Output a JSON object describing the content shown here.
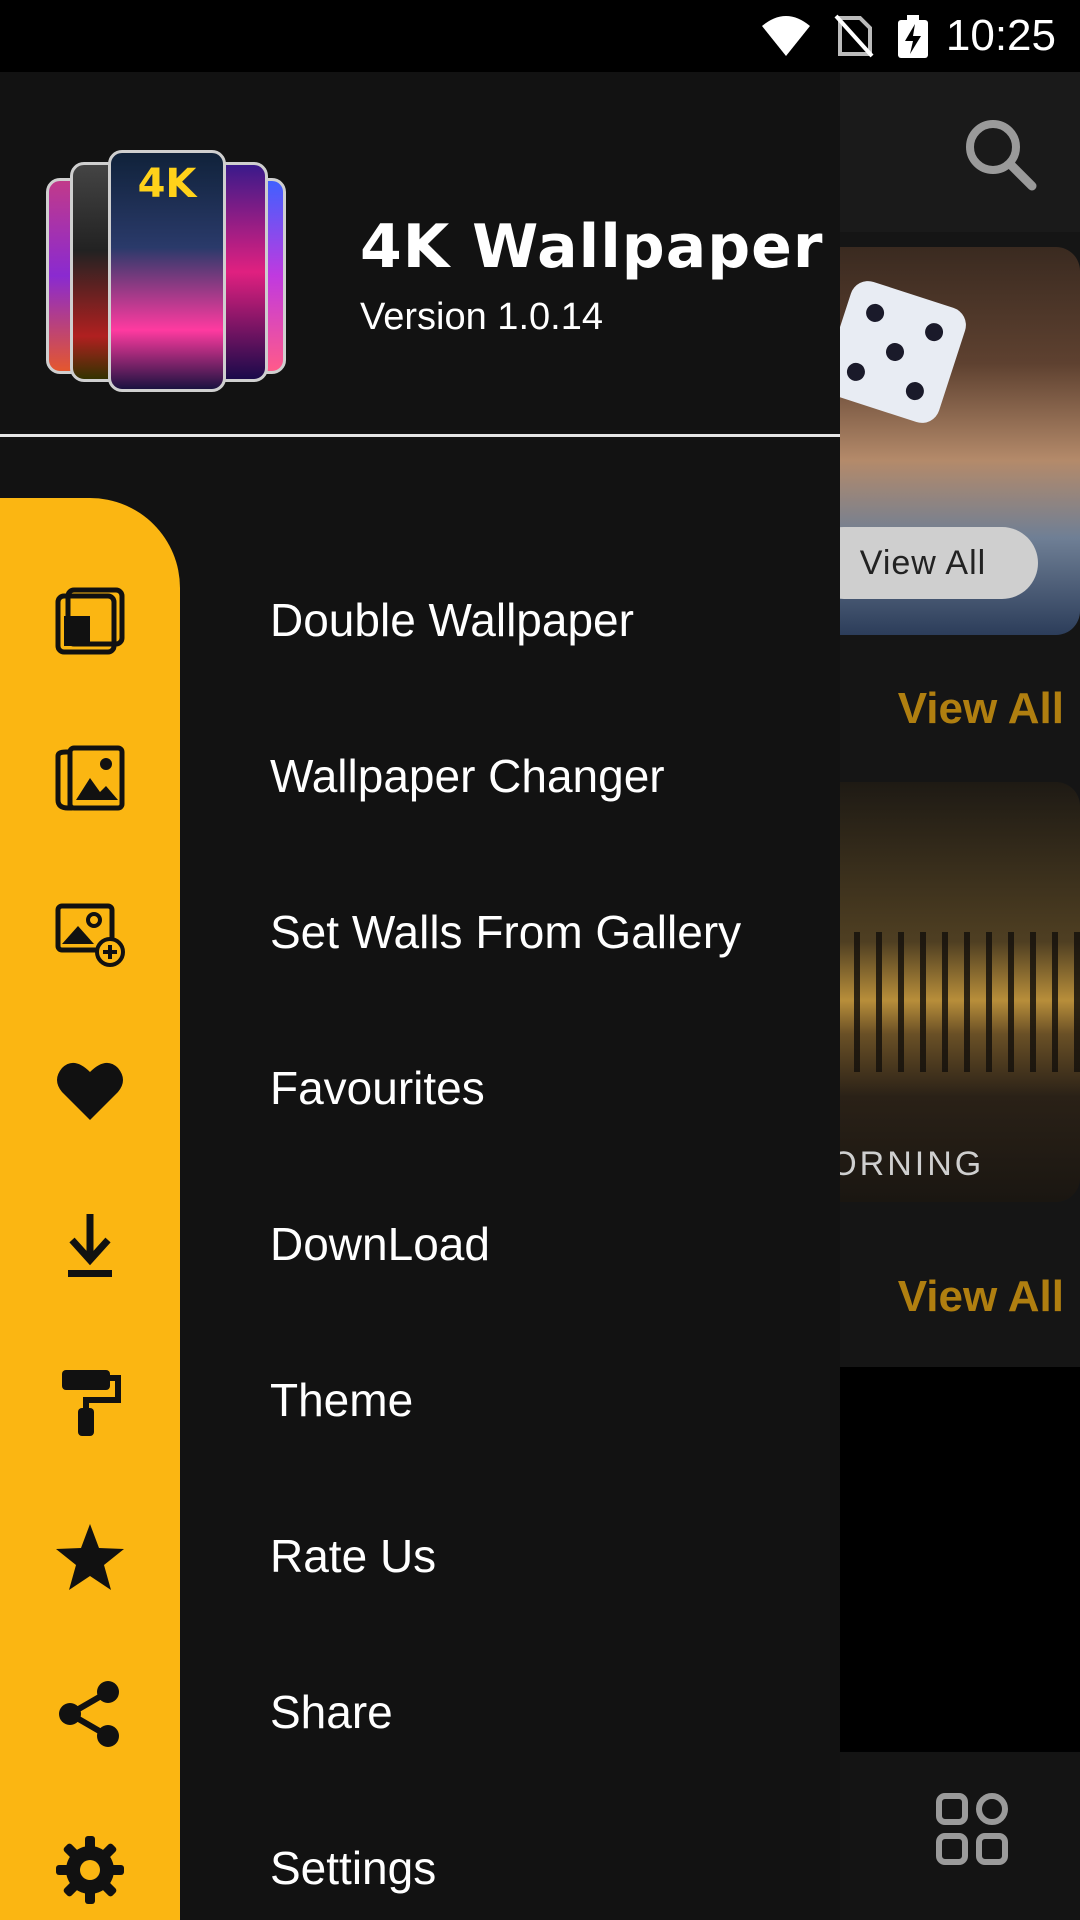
{
  "status_bar": {
    "time": "10:25"
  },
  "app": {
    "title": "4K Wallpaper",
    "version": "Version 1.0.14",
    "logo_text": "4K",
    "accent_color": "#FBB612"
  },
  "menu": {
    "items": [
      {
        "label": "Double Wallpaper",
        "icon": "double-wallpaper-icon"
      },
      {
        "label": "Wallpaper Changer",
        "icon": "wallpaper-changer-icon"
      },
      {
        "label": "Set Walls From Gallery",
        "icon": "gallery-add-icon"
      },
      {
        "label": "Favourites",
        "icon": "heart-icon"
      },
      {
        "label": "DownLoad",
        "icon": "download-icon"
      },
      {
        "label": "Theme",
        "icon": "paint-roller-icon"
      },
      {
        "label": "Rate Us",
        "icon": "star-icon"
      },
      {
        "label": "Share",
        "icon": "share-icon"
      },
      {
        "label": "Settings",
        "icon": "gear-icon"
      }
    ]
  },
  "background": {
    "banner_view_all": "View All",
    "section_view_all_1": "View All",
    "section_view_all_2": "View All",
    "photo_caption": "OOD  MORNING"
  }
}
